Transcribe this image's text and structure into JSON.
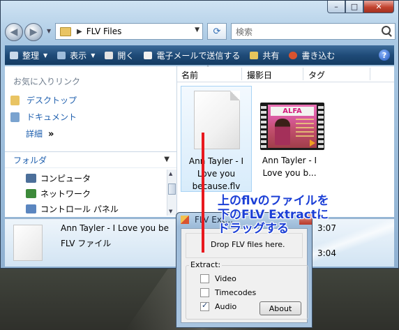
{
  "explorer": {
    "address": {
      "path": "FLV Files"
    },
    "search": {
      "placeholder": "検索"
    },
    "toolbar": {
      "organize": "整理",
      "view": "表示",
      "open": "開く",
      "email": "電子メールで送信する",
      "share": "共有",
      "burn": "書き込む"
    },
    "navpane": {
      "favorites_title": "お気に入りリンク",
      "favorites": [
        "デスクトップ",
        "ドキュメント"
      ],
      "more": "詳細",
      "folders_title": "フォルダ",
      "tree": [
        "コンピュータ",
        "ネットワーク",
        "コントロール パネル"
      ]
    },
    "columns": [
      "名前",
      "撮影日",
      "タグ"
    ],
    "files": [
      {
        "name": "Ann Tayler - I Love you because.flv",
        "label_lines": [
          "Ann Tayler - I",
          "Love you",
          "because.flv"
        ],
        "selected": true,
        "icon": "generic-document-icon"
      },
      {
        "name": "Ann Tayler - I Love you b...",
        "label_lines": [
          "Ann Tayler - I",
          "Love you b..."
        ],
        "selected": false,
        "icon": "video-thumbnail",
        "thumb_text": "ALFA"
      }
    ],
    "details": {
      "name": "Ann Tayler - I Love you be",
      "type": "FLV ファイル",
      "time1": "3:07",
      "time2": "3:04"
    }
  },
  "dialog": {
    "title": "FLV Ext...",
    "drop_text": "Drop FLV files here.",
    "group_label": "Extract:",
    "options": [
      {
        "label": "Video",
        "checked": false
      },
      {
        "label": "Timecodes",
        "checked": false
      },
      {
        "label": "Audio",
        "checked": true
      }
    ],
    "about": "About"
  },
  "annotation": {
    "lines": [
      "上のflvのファイルを",
      "下のFLV Extractに",
      "ドラッグする"
    ],
    "color": "#1b3fd6",
    "line_color": "#e8191e"
  }
}
